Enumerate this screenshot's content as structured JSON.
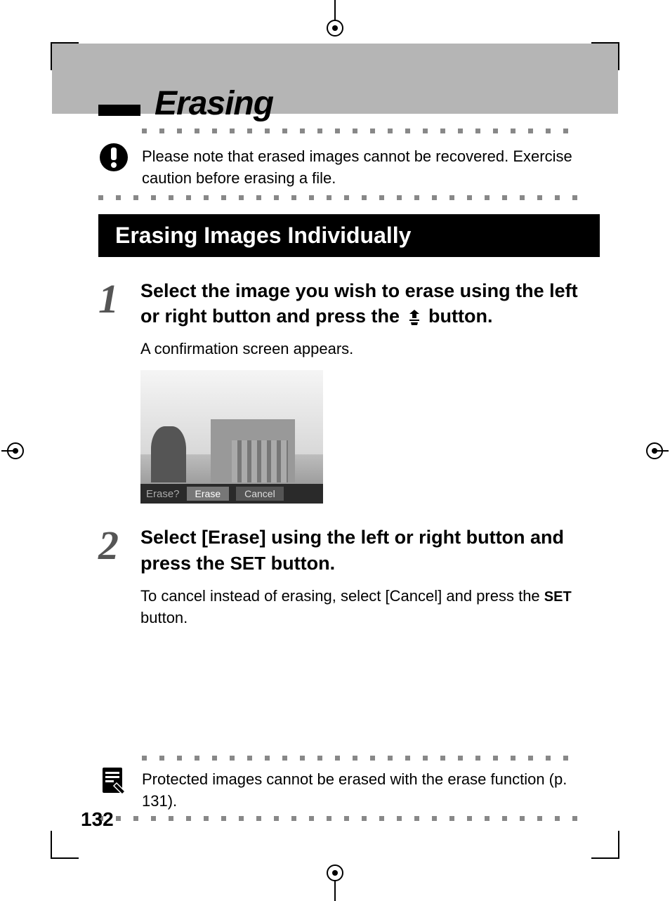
{
  "page": {
    "title": "Erasing",
    "section_heading": "Erasing Images Individually",
    "page_number": "132"
  },
  "caution": {
    "text": "Please note that erased images cannot be recovered. Exercise caution before erasing a file."
  },
  "steps": [
    {
      "number": "1",
      "title_pre": "Select the image you wish to erase using the left or right button and press the ",
      "title_post": " button.",
      "desc": "A confirmation screen appears."
    },
    {
      "number": "2",
      "title_pre": "Select [Erase] using the left or right button and press the ",
      "title_inline": "SET",
      "title_post": " button.",
      "desc_pre": "To cancel instead of erasing, select [Cancel] and press the ",
      "desc_inline": "SET",
      "desc_post": " button."
    }
  ],
  "screenshot_ui": {
    "prompt": "Erase?",
    "option_erase": "Erase",
    "option_cancel": "Cancel"
  },
  "note": {
    "text": "Protected images cannot be erased with the erase function (p. 131)."
  }
}
